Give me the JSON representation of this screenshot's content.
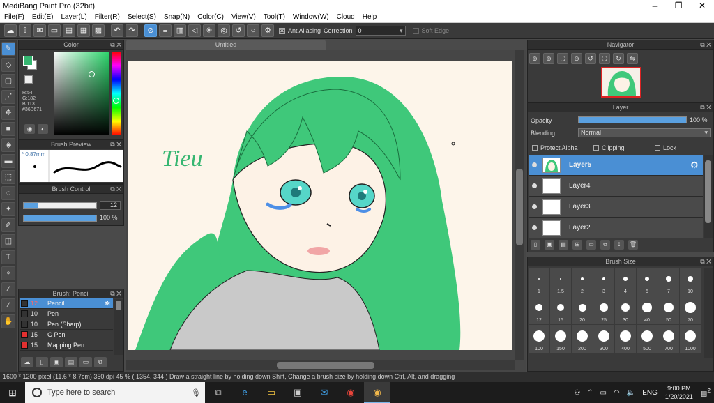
{
  "app": {
    "title": "MediBang Paint Pro (32bit)",
    "window_controls": [
      "–",
      "❐",
      "✕"
    ]
  },
  "menu": [
    "File(F)",
    "Edit(E)",
    "Layer(L)",
    "Filter(R)",
    "Select(S)",
    "Snap(N)",
    "Color(C)",
    "View(V)",
    "Tool(T)",
    "Window(W)",
    "Cloud",
    "Help"
  ],
  "toolbar": {
    "antialiasing_label": "AntiAliasing",
    "antialiasing_checked": true,
    "correction_label": "Correction",
    "correction_value": "0",
    "soft_edge_label": "Soft Edge",
    "soft_edge_checked": false
  },
  "color_panel": {
    "title": "Color",
    "r": "R:54",
    "g": "G:182",
    "b": "B:113",
    "hex": "#36B671",
    "foreground": "#36B671"
  },
  "brush_preview": {
    "title": "Brush Preview",
    "size": "0.87mm"
  },
  "brush_control": {
    "title": "Brush Control",
    "size_value": "12",
    "size_fraction": 0.2,
    "opacity_value": "100 %",
    "opacity_fraction": 1.0
  },
  "brush_list": {
    "title": "Brush: Pencil",
    "items": [
      {
        "size": "12",
        "name": "Pencil",
        "color": "#36B671",
        "selected": true
      },
      {
        "size": "10",
        "name": "Pen",
        "color": "#222222",
        "selected": false
      },
      {
        "size": "10",
        "name": "Pen (Sharp)",
        "color": "#222222",
        "selected": false
      },
      {
        "size": "15",
        "name": "G Pen",
        "color": "#e23030",
        "selected": false
      },
      {
        "size": "15",
        "name": "Mapping Pen",
        "color": "#e23030",
        "selected": false
      }
    ]
  },
  "document": {
    "tab_title": "Untitled",
    "canvas_text": "Tieu"
  },
  "navigator": {
    "title": "Navigator"
  },
  "layer_panel": {
    "title": "Layer",
    "opacity_label": "Opacity",
    "opacity_value": "100 %",
    "blending_label": "Blending",
    "blending_value": "Normal",
    "protect_alpha": "Protect Alpha",
    "clipping": "Clipping",
    "lock": "Lock",
    "layers": [
      {
        "name": "Layer5",
        "selected": true
      },
      {
        "name": "Layer4",
        "selected": false
      },
      {
        "name": "Layer3",
        "selected": false
      },
      {
        "name": "Layer2",
        "selected": false
      }
    ]
  },
  "brush_size": {
    "title": "Brush Size",
    "sizes": [
      "1",
      "1.5",
      "2",
      "3",
      "4",
      "5",
      "7",
      "10",
      "12",
      "15",
      "20",
      "25",
      "30",
      "40",
      "50",
      "70",
      "100",
      "150",
      "200",
      "300",
      "400",
      "500",
      "700",
      "1000"
    ]
  },
  "status": {
    "text": "1600 * 1200 pixel   (11.6 * 8.7cm)   350 dpi   45 %   ( 1354, 344 )   Draw a straight line by holding down Shift, Change a brush size by holding down Ctrl, Alt, and dragging"
  },
  "taskbar": {
    "search_placeholder": "Type here to search",
    "language": "ENG",
    "time": "9:00 PM",
    "date": "1/20/2021",
    "notification_count": "2"
  },
  "colors": {
    "accent": "#4a8fd4",
    "hair_green": "#3fc87a"
  }
}
